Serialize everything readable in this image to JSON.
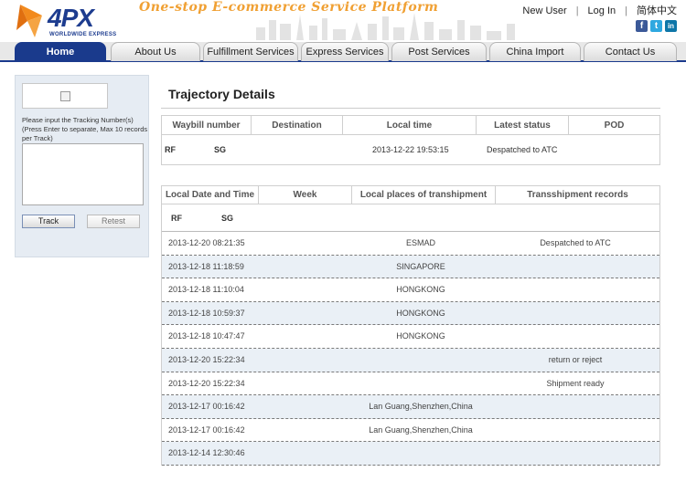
{
  "header": {
    "logo_text": "4PX",
    "logo_subtitle": "WORLDWIDE EXPRESS",
    "slogan": "One-stop E-commerce Service Platform",
    "links": {
      "new_user": "New User",
      "login": "Log In",
      "language": "简体中文"
    },
    "social": [
      {
        "name": "facebook",
        "glyph": "f",
        "color": "#3b5998"
      },
      {
        "name": "twitter",
        "glyph": "t",
        "color": "#2fa8e0"
      },
      {
        "name": "linkedin",
        "glyph": "in",
        "color": "#0e76a8"
      }
    ]
  },
  "nav": {
    "tabs": [
      {
        "label": "Home",
        "active": true
      },
      {
        "label": "About Us"
      },
      {
        "label": "Fulfillment Services"
      },
      {
        "label": "Express Services"
      },
      {
        "label": "Post Services"
      },
      {
        "label": "China Import"
      },
      {
        "label": "Contact Us"
      }
    ]
  },
  "sidebar": {
    "hint": "Please input the Tracking Number(s) (Press Enter to separate, Max 10 records per Track)",
    "track_label": "Track",
    "reset_label": "Retest"
  },
  "main": {
    "title": "Trajectory Details",
    "summary": {
      "headers": [
        "Waybill number",
        "Destination",
        "Local time",
        "Latest status",
        "POD"
      ],
      "row": {
        "waybill_prefix": "RF",
        "waybill_suffix": "SG",
        "local_time": "2013-12-22 19:53:15",
        "status": "Despatched to ATC"
      }
    },
    "details": {
      "headers": [
        "Local Date and Time",
        "Week",
        "Local places of transhipment",
        "Transshipment records"
      ],
      "id_prefix": "RF",
      "id_suffix": "SG",
      "rows": [
        {
          "date": "2013-12-20 08:21:35",
          "place": "ESMAD",
          "record": "Despatched to ATC"
        },
        {
          "date": "2013-12-18 11:18:59",
          "place": "SINGAPORE",
          "record": ""
        },
        {
          "date": "2013-12-18 11:10:04",
          "place": "HONGKONG",
          "record": ""
        },
        {
          "date": "2013-12-18 10:59:37",
          "place": "HONGKONG",
          "record": ""
        },
        {
          "date": "2013-12-18 10:47:47",
          "place": "HONGKONG",
          "record": ""
        },
        {
          "date": "2013-12-20 15:22:34",
          "place": "",
          "record": "return or reject"
        },
        {
          "date": "2013-12-20 15:22:34",
          "place": "",
          "record": "Shipment ready"
        },
        {
          "date": "2013-12-17 00:16:42",
          "place": "Lan Guang,Shenzhen,China",
          "record": ""
        },
        {
          "date": "2013-12-17 00:16:42",
          "place": "Lan Guang,Shenzhen,China",
          "record": ""
        },
        {
          "date": "2013-12-14 12:30:46",
          "place": "",
          "record": ""
        }
      ]
    }
  },
  "colors": {
    "brand_blue": "#1a3a8c",
    "slogan_orange": "#f0a033",
    "logo_orange": "#f28a1d"
  }
}
